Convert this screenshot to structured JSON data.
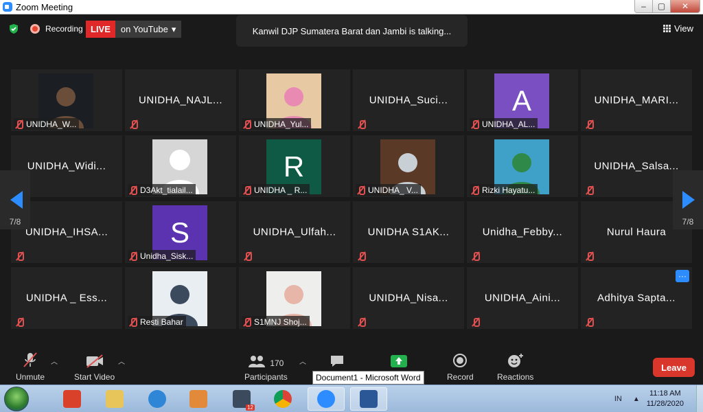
{
  "window": {
    "title": "Zoom Meeting",
    "min": "–",
    "max": "▢",
    "close": "✕"
  },
  "topbar": {
    "recording_label": "Recording",
    "live_label": "LIVE",
    "live_target": "on YouTube",
    "talking": "Kanwil DJP Sumatera Barat dan Jambi is talking...",
    "view_label": "View"
  },
  "nav": {
    "page_left": "7/8",
    "page_right": "7/8"
  },
  "tiles": [
    {
      "label": "UNIDHA_W...",
      "kind": "photo",
      "bg": "#1b1e23",
      "fg": "#6a4e3a"
    },
    {
      "name": "UNIDHA_NAJL...",
      "kind": "name"
    },
    {
      "label": "UNIDHA_Yul...",
      "kind": "photo",
      "bg": "#e7c9a4",
      "fg": "#e88ab2"
    },
    {
      "name": "UNIDHA_Suci...",
      "kind": "name"
    },
    {
      "label": "UNIDHA_AL...",
      "kind": "letter",
      "letter": "A",
      "bg": "#7a4fc2"
    },
    {
      "name": "UNIDHA_MARI...",
      "kind": "name"
    },
    {
      "name": "UNIDHA_Widi...",
      "kind": "name"
    },
    {
      "label": "D3Akt_tialail...",
      "kind": "avatar"
    },
    {
      "label": "UNIDHA _ R...",
      "kind": "letter",
      "letter": "R",
      "bg": "#0f5a44"
    },
    {
      "label": "UNIDHA_ V...",
      "kind": "photo",
      "bg": "#5a3a26",
      "fg": "#c8d0d6"
    },
    {
      "label": "Rizki Hayatu...",
      "kind": "photo",
      "bg": "#3fa0c8",
      "fg": "#2f8a4a"
    },
    {
      "name": "UNIDHA_Salsa...",
      "kind": "name"
    },
    {
      "name": "UNIDHA_IHSA...",
      "kind": "name"
    },
    {
      "label": "Unidha_Sisk...",
      "kind": "letter",
      "letter": "S",
      "bg": "#5b33b0"
    },
    {
      "name": "UNIDHA_Ulfah...",
      "kind": "name"
    },
    {
      "name": "UNIDHA  S1AK...",
      "kind": "name"
    },
    {
      "name": "Unidha_Febby...",
      "kind": "name"
    },
    {
      "name": "Nurul Haura",
      "kind": "name"
    },
    {
      "name": "UNIDHA _ Ess...",
      "kind": "name"
    },
    {
      "label": "Resti Bahar",
      "kind": "photo",
      "bg": "#e9eef2",
      "fg": "#3b4a5c"
    },
    {
      "label": "S1MNJ Shoj...",
      "kind": "photo",
      "bg": "#eeeeec",
      "fg": "#e8b6a8"
    },
    {
      "name": "UNIDHA_Nisa...",
      "kind": "name"
    },
    {
      "name": "UNIDHA_Aini...",
      "kind": "name"
    },
    {
      "name": "Adhitya  Sapta...",
      "kind": "name",
      "more": true
    }
  ],
  "toolbar": {
    "unmute": "Unmute",
    "start_video": "Start Video",
    "participants": "Participants",
    "participants_count": "170",
    "record": "Record",
    "reactions": "Reactions",
    "leave": "Leave",
    "tooltip": "Document1 - Microsoft Word"
  },
  "taskbar": {
    "lang": "IN",
    "time": "11:18 AM",
    "date": "11/28/2020",
    "notif_badge": "12"
  },
  "colors": {
    "accent": "#2d8cff",
    "live": "#e02828",
    "leave": "#d9362c",
    "muted": "#e05050"
  }
}
